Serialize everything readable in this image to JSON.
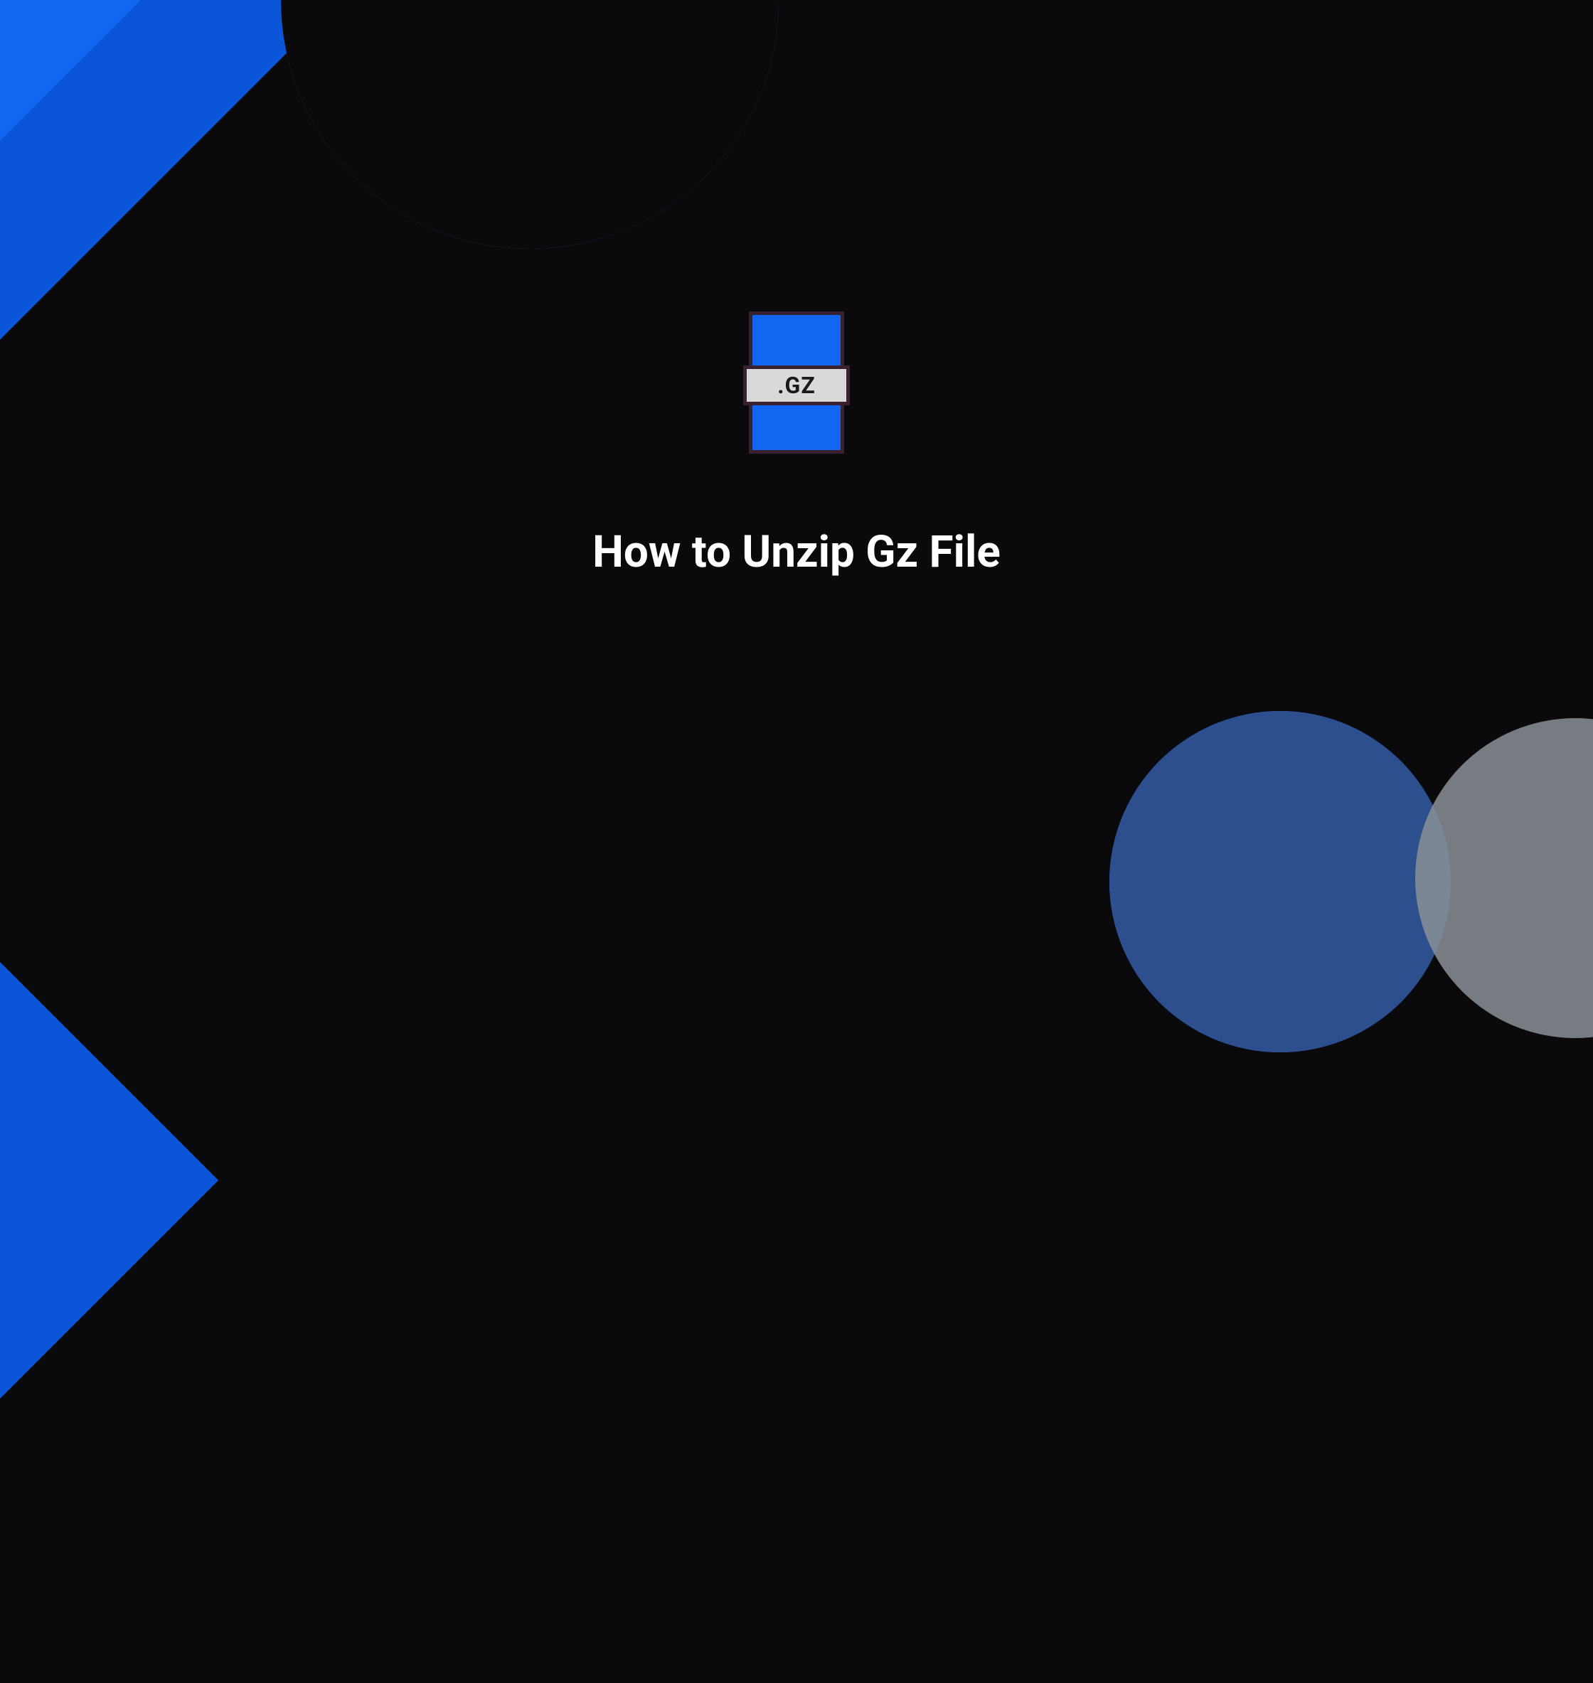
{
  "icon": {
    "extension": ".GZ"
  },
  "title": "How to Unzip Gz File",
  "colors": {
    "background": "#0a0a0d",
    "blue_primary": "#1266f1",
    "blue_dark": "#0b55d8",
    "blue_light": "#3a86ff",
    "gray": "#899097",
    "blue_muted": "#2d4f8e",
    "icon_border": "#3a1f2e",
    "label_bg": "#d9d9d9"
  }
}
